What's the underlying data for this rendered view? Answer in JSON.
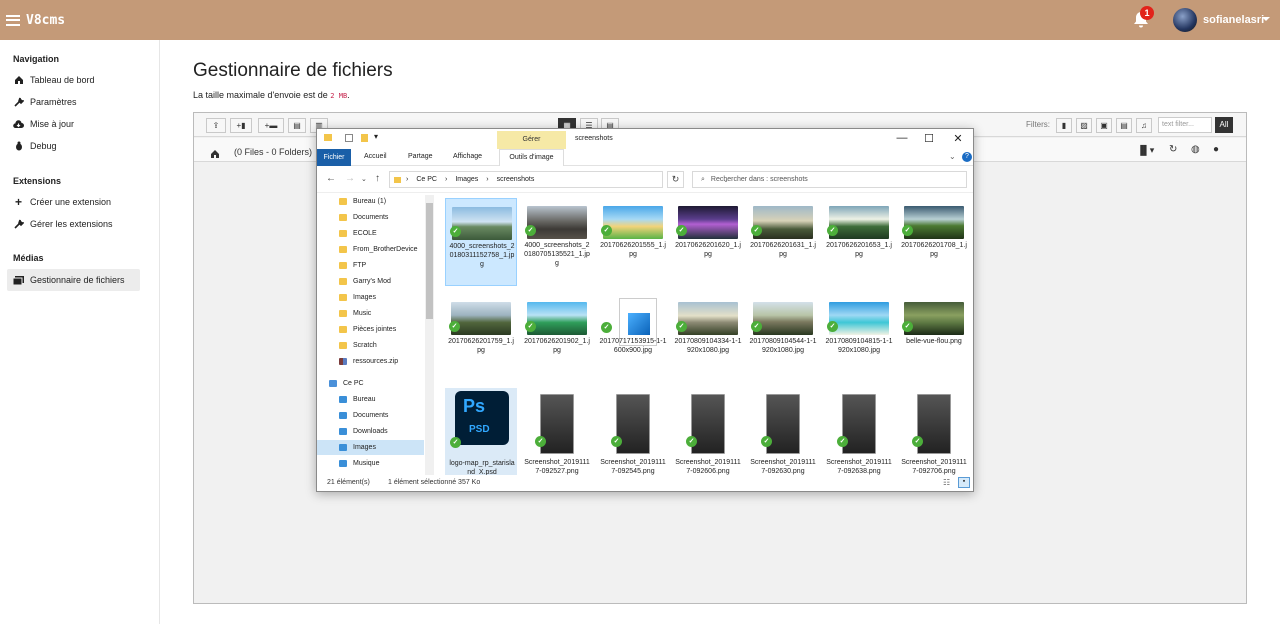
{
  "app": {
    "brand": "V8cms",
    "notifications": "1",
    "username": "sofianelasri"
  },
  "sidebar": {
    "navigation_title": "Navigation",
    "nav_items": [
      {
        "label": "Tableau de bord",
        "icon": "gauge-icon"
      },
      {
        "label": "Paramètres",
        "icon": "wrench-icon"
      },
      {
        "label": "Mise à jour",
        "icon": "cloud-download-icon"
      },
      {
        "label": "Debug",
        "icon": "bug-icon"
      }
    ],
    "extensions_title": "Extensions",
    "ext_items": [
      {
        "label": "Créer une extension",
        "icon": "plus-icon"
      },
      {
        "label": "Gérer les extensions",
        "icon": "wrench-icon"
      }
    ],
    "media_title": "Médias",
    "media_items": [
      {
        "label": "Gestionnaire de fichiers",
        "icon": "images-icon"
      }
    ]
  },
  "page": {
    "title": "Gestionnaire de fichiers",
    "subtitle_prefix": "La taille maximale d'envoie est de ",
    "subtitle_size": "2 MB",
    "subtitle_suffix": "."
  },
  "filemanager": {
    "filters_label": "Filters:",
    "filter_placeholder": "text filter...",
    "all_label": "All",
    "path_text": "(0 Files - 0 Folders)"
  },
  "explorer": {
    "context_tab": "Gérer",
    "window_title": "screenshots",
    "ribbon_tabs": [
      "Fichier",
      "Accueil",
      "Partage",
      "Affichage",
      "Outils d'image"
    ],
    "breadcrumb": [
      "Ce PC",
      "Images",
      "screenshots"
    ],
    "search_placeholder": "Rechercher dans : screenshots",
    "nav_items": [
      "Bureau (1)",
      "Documents",
      "ECOLE",
      "From_BrotherDevice",
      "FTP",
      "Garry's Mod",
      "Images",
      "Music",
      "Pièces jointes",
      "Scratch",
      "ressources.zip",
      "Ce PC",
      "Bureau",
      "Documents",
      "Downloads",
      "Images",
      "Musique"
    ],
    "files": [
      "4000_screenshots_20180311152758_1.jpg",
      "4000_screenshots_20180705135521_1.jpg",
      "20170626201555_1.jpg",
      "20170626201620_1.jpg",
      "20170626201631_1.jpg",
      "20170626201653_1.jpg",
      "20170626201708_1.jpg",
      "20170626201759_1.jpg",
      "20170626201902_1.jpg",
      "20170717153915-1-1600x900.jpg",
      "20170809104334-1-1920x1080.jpg",
      "20170809104544-1-1920x1080.jpg",
      "20170809104815-1-1920x1080.jpg",
      "belle-vue-flou.png",
      "logo-map_rp_starisland_X.psd",
      "Screenshot_20191117-092527.png",
      "Screenshot_20191117-092545.png",
      "Screenshot_20191117-092606.png",
      "Screenshot_20191117-092630.png",
      "Screenshot_20191117-092638.png",
      "Screenshot_20191117-092706.png"
    ],
    "status_count": "21 élément(s)",
    "status_selected": "1 élément sélectionné  357 Ko"
  },
  "colors": {
    "topbar": "#c49a78",
    "selected": "#cce4f7",
    "sync_check": "#4cae3a"
  }
}
